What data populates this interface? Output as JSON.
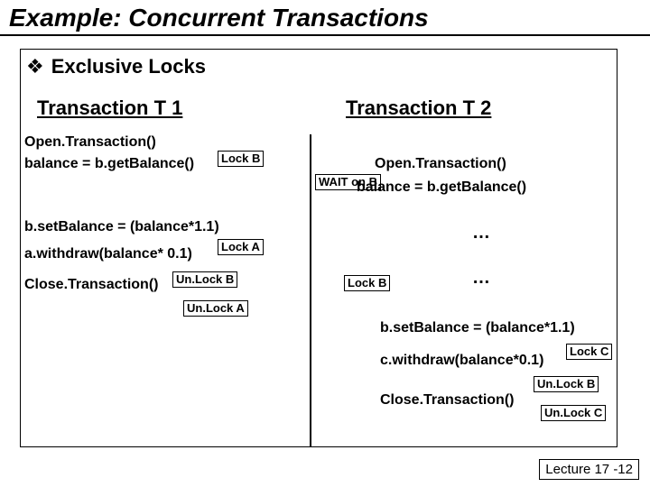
{
  "title": "Example: Concurrent Transactions",
  "bullet": "Exclusive Locks",
  "t1_header": "Transaction T 1",
  "t2_header": "Transaction T 2",
  "t1": {
    "open": "Open.Transaction()",
    "getbal": "balance = b.getBalance()",
    "lockB": "Lock\nB",
    "setbal": "b.setBalance = (balance*1.1)",
    "withdraw": "a.withdraw(balance* 0.1)",
    "lockA": "Lock\nA",
    "close": "Close.Transaction()",
    "unlockB": "Un.Lock\nB",
    "unlockA": "Un.Lock\nA"
  },
  "waitB": "WAIT\non B",
  "t2": {
    "open": "Open.Transaction()",
    "getbal": "balance = b.getBalance()",
    "dots1": "…",
    "dots2": "…",
    "lockB": "Lock\nB",
    "setbal": "b.setBalance = (balance*1.1)",
    "withdraw": "c.withdraw(balance*0.1)",
    "lockC": "Lock\nC",
    "close": "Close.Transaction()",
    "unlockB": "Un.Lock\nB",
    "unlockC": "Un.Lock\nC"
  },
  "footer": "Lecture 17 -12"
}
